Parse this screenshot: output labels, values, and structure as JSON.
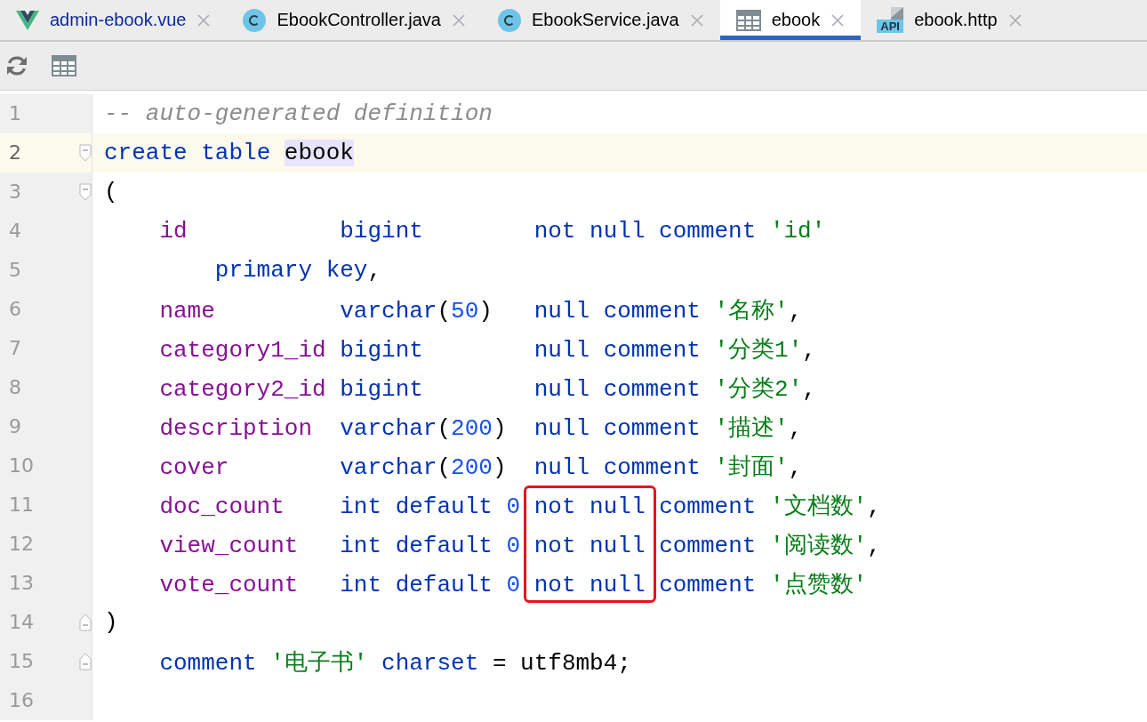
{
  "tabs": [
    {
      "label": "admin-ebook.vue",
      "kind": "vue",
      "modified": true,
      "selected": false
    },
    {
      "label": "EbookController.java",
      "kind": "class",
      "modified": false,
      "selected": false
    },
    {
      "label": "EbookService.java",
      "kind": "class",
      "modified": false,
      "selected": false
    },
    {
      "label": "ebook",
      "kind": "table",
      "modified": false,
      "selected": true
    },
    {
      "label": "ebook.http",
      "kind": "api",
      "badge": "API",
      "modified": false,
      "selected": false
    }
  ],
  "toolbar": [
    {
      "kind": "refresh"
    },
    {
      "kind": "table"
    }
  ],
  "editor": {
    "lines": [
      {
        "number": "1",
        "kind": "plain",
        "current": false,
        "fold_start": false,
        "fold_end": false,
        "segments": [
          [
            {
              "text": "-- auto-generated definition",
              "kind": "comment"
            }
          ]
        ]
      },
      {
        "number": "2",
        "kind": "plain",
        "current": true,
        "fold_start": true,
        "fold_end": false,
        "segments": [
          [
            {
              "text": "create table",
              "kind": "keyword"
            },
            {
              "text": "ebook",
              "kind": "match"
            }
          ]
        ]
      },
      {
        "number": "3",
        "kind": "plain",
        "current": false,
        "fold_start": true,
        "fold_end": false,
        "segments": [
          [
            {
              "text": "(",
              "kind": "plain"
            }
          ]
        ]
      },
      {
        "number": "4",
        "kind": "column_def",
        "current": false,
        "fold_start": false,
        "fold_end": false,
        "segments": [
          [
            {
              "text": "id",
              "kind": "column"
            }
          ],
          [
            {
              "text": "bigint",
              "kind": "keyword"
            }
          ],
          [
            {
              "text": "not null comment",
              "kind": "keyword"
            },
            {
              "text": "'id'",
              "kind": "string"
            }
          ]
        ]
      },
      {
        "number": "5",
        "kind": "nested",
        "current": false,
        "fold_start": false,
        "fold_end": false,
        "segments": [
          [
            {
              "text": "primary key",
              "kind": "keyword"
            },
            {
              "text": ",",
              "kind": "plain",
              "joined": true
            }
          ]
        ]
      },
      {
        "number": "6",
        "kind": "column_def",
        "current": false,
        "fold_start": false,
        "fold_end": false,
        "segments": [
          [
            {
              "text": "name",
              "kind": "column"
            }
          ],
          [
            {
              "text": "varchar",
              "kind": "keyword"
            },
            {
              "text": "(",
              "kind": "plain",
              "joined": true
            },
            {
              "text": "50",
              "kind": "number",
              "joined": true
            },
            {
              "text": ")",
              "kind": "plain",
              "joined": true
            }
          ],
          [
            {
              "text": "null comment",
              "kind": "keyword"
            },
            {
              "text": "'名称'",
              "kind": "string"
            },
            {
              "text": ",",
              "kind": "plain",
              "joined": true
            }
          ]
        ]
      },
      {
        "number": "7",
        "kind": "column_def",
        "current": false,
        "fold_start": false,
        "fold_end": false,
        "segments": [
          [
            {
              "text": "category1_id",
              "kind": "column"
            }
          ],
          [
            {
              "text": "bigint",
              "kind": "keyword"
            }
          ],
          [
            {
              "text": "null comment",
              "kind": "keyword"
            },
            {
              "text": "'分类1'",
              "kind": "string"
            },
            {
              "text": ",",
              "kind": "plain",
              "joined": true
            }
          ]
        ]
      },
      {
        "number": "8",
        "kind": "column_def",
        "current": false,
        "fold_start": false,
        "fold_end": false,
        "segments": [
          [
            {
              "text": "category2_id",
              "kind": "column"
            }
          ],
          [
            {
              "text": "bigint",
              "kind": "keyword"
            }
          ],
          [
            {
              "text": "null comment",
              "kind": "keyword"
            },
            {
              "text": "'分类2'",
              "kind": "string"
            },
            {
              "text": ",",
              "kind": "plain",
              "joined": true
            }
          ]
        ]
      },
      {
        "number": "9",
        "kind": "column_def",
        "current": false,
        "fold_start": false,
        "fold_end": false,
        "segments": [
          [
            {
              "text": "description",
              "kind": "column"
            }
          ],
          [
            {
              "text": "varchar",
              "kind": "keyword"
            },
            {
              "text": "(",
              "kind": "plain",
              "joined": true
            },
            {
              "text": "200",
              "kind": "number",
              "joined": true
            },
            {
              "text": ")",
              "kind": "plain",
              "joined": true
            }
          ],
          [
            {
              "text": "null comment",
              "kind": "keyword"
            },
            {
              "text": "'描述'",
              "kind": "string"
            },
            {
              "text": ",",
              "kind": "plain",
              "joined": true
            }
          ]
        ]
      },
      {
        "number": "10",
        "kind": "column_def",
        "current": false,
        "fold_start": false,
        "fold_end": false,
        "segments": [
          [
            {
              "text": "cover",
              "kind": "column"
            }
          ],
          [
            {
              "text": "varchar",
              "kind": "keyword"
            },
            {
              "text": "(",
              "kind": "plain",
              "joined": true
            },
            {
              "text": "200",
              "kind": "number",
              "joined": true
            },
            {
              "text": ")",
              "kind": "plain",
              "joined": true
            }
          ],
          [
            {
              "text": "null comment",
              "kind": "keyword"
            },
            {
              "text": "'封面'",
              "kind": "string"
            },
            {
              "text": ",",
              "kind": "plain",
              "joined": true
            }
          ]
        ]
      },
      {
        "number": "11",
        "kind": "column_def",
        "current": false,
        "fold_start": false,
        "fold_end": false,
        "segments": [
          [
            {
              "text": "doc_count",
              "kind": "column"
            }
          ],
          [
            {
              "text": "int default",
              "kind": "keyword"
            },
            {
              "text": "0",
              "kind": "number"
            },
            {
              "text": "not null",
              "kind": "keyword",
              "boxed": true
            },
            {
              "text": "comment",
              "kind": "keyword"
            },
            {
              "text": "'文档数'",
              "kind": "string"
            },
            {
              "text": ",",
              "kind": "plain",
              "joined": true
            }
          ]
        ]
      },
      {
        "number": "12",
        "kind": "column_def",
        "current": false,
        "fold_start": false,
        "fold_end": false,
        "segments": [
          [
            {
              "text": "view_count",
              "kind": "column"
            }
          ],
          [
            {
              "text": "int default",
              "kind": "keyword"
            },
            {
              "text": "0",
              "kind": "number"
            },
            {
              "text": "not null",
              "kind": "keyword",
              "boxed": true
            },
            {
              "text": "comment",
              "kind": "keyword"
            },
            {
              "text": "'阅读数'",
              "kind": "string"
            },
            {
              "text": ",",
              "kind": "plain",
              "joined": true
            }
          ]
        ]
      },
      {
        "number": "13",
        "kind": "column_def",
        "current": false,
        "fold_start": false,
        "fold_end": false,
        "segments": [
          [
            {
              "text": "vote_count",
              "kind": "column"
            }
          ],
          [
            {
              "text": "int default",
              "kind": "keyword"
            },
            {
              "text": "0",
              "kind": "number"
            },
            {
              "text": "not null",
              "kind": "keyword",
              "boxed": true
            },
            {
              "text": "comment",
              "kind": "keyword"
            },
            {
              "text": "'点赞数'",
              "kind": "string"
            }
          ]
        ]
      },
      {
        "number": "14",
        "kind": "plain",
        "current": false,
        "fold_start": false,
        "fold_end": true,
        "segments": [
          [
            {
              "text": ")",
              "kind": "plain"
            }
          ]
        ]
      },
      {
        "number": "15",
        "kind": "indented",
        "current": false,
        "fold_start": false,
        "fold_end": true,
        "segments": [
          [
            {
              "text": "comment",
              "kind": "keyword"
            },
            {
              "text": "'电子书'",
              "kind": "string"
            },
            {
              "text": "charset",
              "kind": "keyword"
            },
            {
              "text": "=",
              "kind": "plain"
            },
            {
              "text": "utf8mb4;",
              "kind": "plain"
            }
          ]
        ]
      },
      {
        "number": "16",
        "kind": "plain",
        "current": false,
        "fold_start": false,
        "fold_end": false
      }
    ]
  }
}
